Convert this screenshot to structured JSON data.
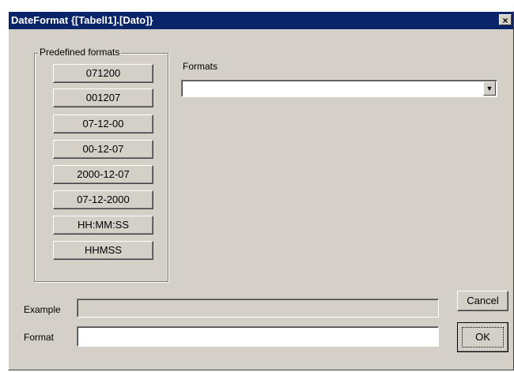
{
  "window": {
    "title": "DateFormat {[Tabell1].[Dato]}",
    "close_glyph": "×"
  },
  "predefined": {
    "group_label": "Predefined formats",
    "buttons": [
      "071200",
      "001207",
      "07-12-00",
      "00-12-07",
      "2000-12-07",
      "07-12-2000",
      "HH:MM:SS",
      "HHMSS"
    ]
  },
  "formats": {
    "label": "Formats",
    "value": "",
    "arrow_glyph": "▼"
  },
  "example": {
    "label": "Example",
    "value": ""
  },
  "format": {
    "label": "Format",
    "value": ""
  },
  "actions": {
    "cancel_label": "Cancel",
    "ok_label": "OK"
  }
}
